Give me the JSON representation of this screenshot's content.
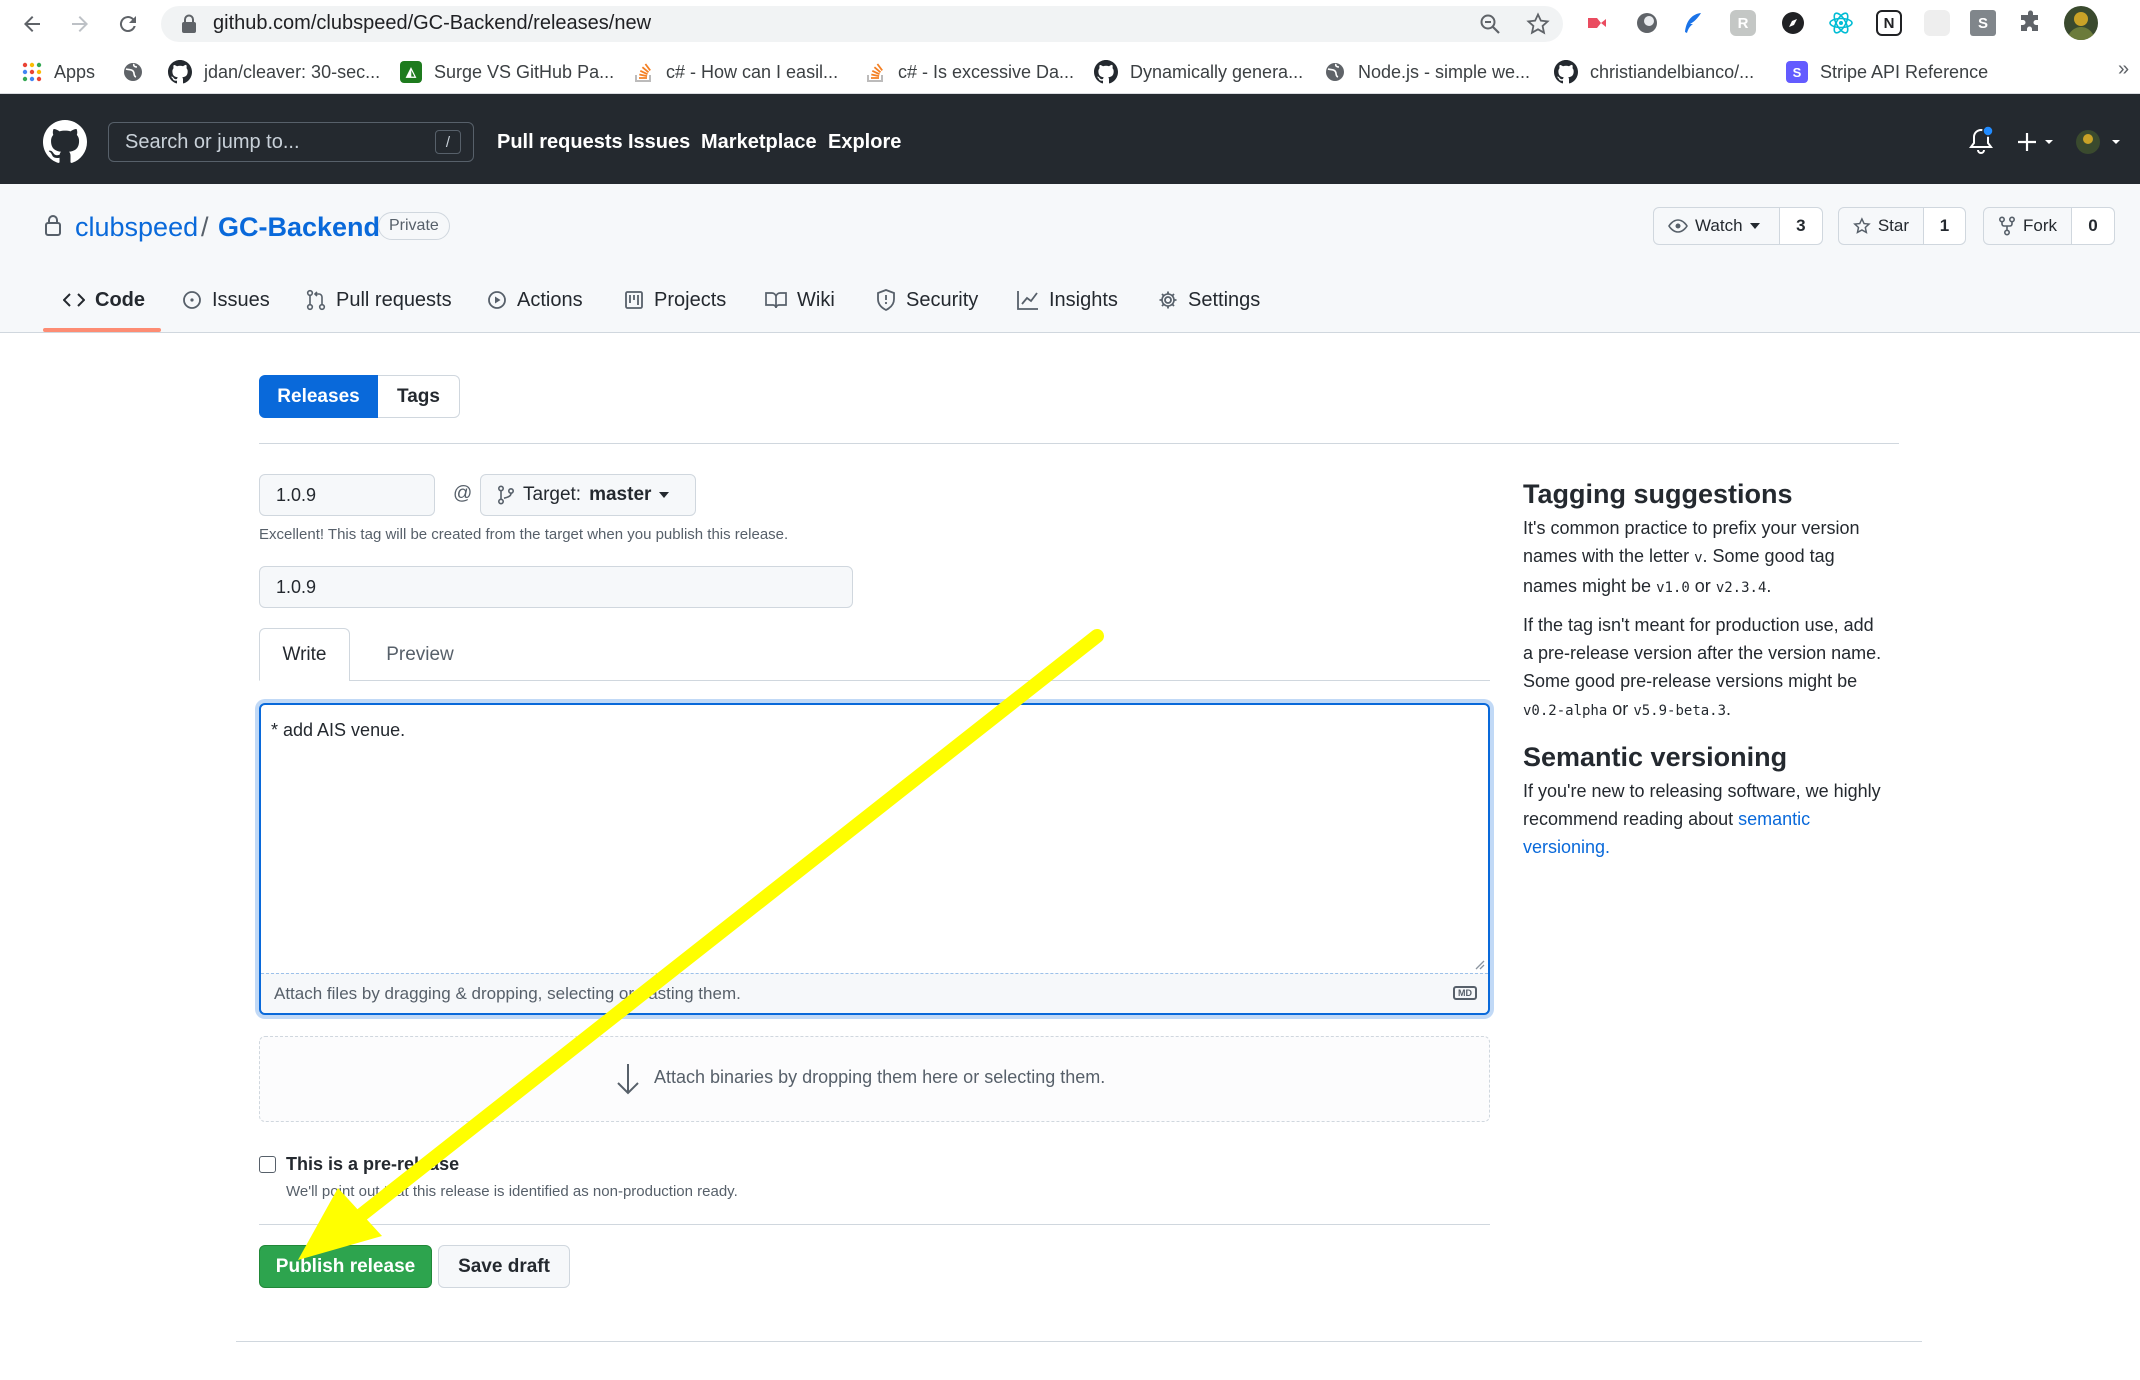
{
  "browser": {
    "url": "github.com/clubspeed/GC-Backend/releases/new",
    "bookmarks": [
      {
        "label": "Apps",
        "icon": "apps-grid-icon"
      },
      {
        "label": "jdan/cleaver: 30-sec...",
        "icon": "github-icon"
      },
      {
        "label": "Surge VS GitHub Pa...",
        "icon": "surge-icon"
      },
      {
        "label": "c# - How can I easil...",
        "icon": "stackoverflow-icon"
      },
      {
        "label": "c# - Is excessive Da...",
        "icon": "stackoverflow-icon"
      },
      {
        "label": "Dynamically genera...",
        "icon": "github-icon"
      },
      {
        "label": "Node.js - simple we...",
        "icon": "globe-icon"
      },
      {
        "label": "christiandelbianco/...",
        "icon": "github-icon"
      },
      {
        "label": "Stripe API Reference",
        "icon": "stripe-icon"
      }
    ],
    "extension_letters": [
      "R",
      "N",
      "S"
    ],
    "more_bookmarks": "»"
  },
  "github": {
    "search_placeholder": "Search or jump to...",
    "search_key": "/",
    "nav": [
      "Pull requests",
      "Issues",
      "Marketplace",
      "Explore"
    ]
  },
  "repo": {
    "owner": "clubspeed",
    "separator": "/",
    "name": "GC-Backend",
    "visibility": "Private",
    "watch": {
      "label": "Watch",
      "count": "3"
    },
    "star": {
      "label": "Star",
      "count": "1"
    },
    "fork": {
      "label": "Fork",
      "count": "0"
    },
    "tabs": [
      "Code",
      "Issues",
      "Pull requests",
      "Actions",
      "Projects",
      "Wiki",
      "Security",
      "Insights",
      "Settings"
    ]
  },
  "release_form": {
    "segments": {
      "releases": "Releases",
      "tags": "Tags"
    },
    "tag_value": "1.0.9",
    "at": "@",
    "target_label": "Target:",
    "target_value": "master",
    "tag_hint": "Excellent! This tag will be created from the target when you publish this release.",
    "title_value": "1.0.9",
    "editor_tabs": {
      "write": "Write",
      "preview": "Preview"
    },
    "body_text": "* add AIS venue.",
    "attach_hint": "Attach files by dragging & dropping, selecting or pasting them.",
    "md_badge": "MD",
    "binaries_hint": "Attach binaries by dropping them here or selecting them.",
    "prerelease_label": "This is a pre-release",
    "prerelease_note": "We'll point out that this release is identified as non-production ready.",
    "prerelease_checked": false,
    "publish_label": "Publish release",
    "draft_label": "Save draft"
  },
  "sidebar": {
    "tagging_title": "Tagging suggestions",
    "tagging_p1": {
      "line1": "It's common practice to prefix your version",
      "line2a": "names with the letter ",
      "code_v": "v",
      "line2b": ". Some good tag",
      "line3a": "names might be ",
      "code_a": "v1.0",
      "or1": " or ",
      "code_b": "v2.3.4",
      "end": "."
    },
    "tagging_p2": {
      "line1": "If the tag isn't meant for production use, add",
      "line2": "a pre-release version after the version name.",
      "line3": "Some good pre-release versions might be",
      "code_a": "v0.2-alpha",
      "or1": " or ",
      "code_b": "v5.9-beta.3",
      "end": "."
    },
    "semver_title": "Semantic versioning",
    "semver_p": {
      "line1": "If you're new to releasing software, we highly",
      "line2a": "recommend reading about ",
      "link_a": "semantic",
      "link_b": "versioning."
    }
  },
  "colors": {
    "annotation_arrow": "#ffff00",
    "publish_green": "#2da44e",
    "accent_blue": "#0969da",
    "header_dark": "#24292f"
  }
}
